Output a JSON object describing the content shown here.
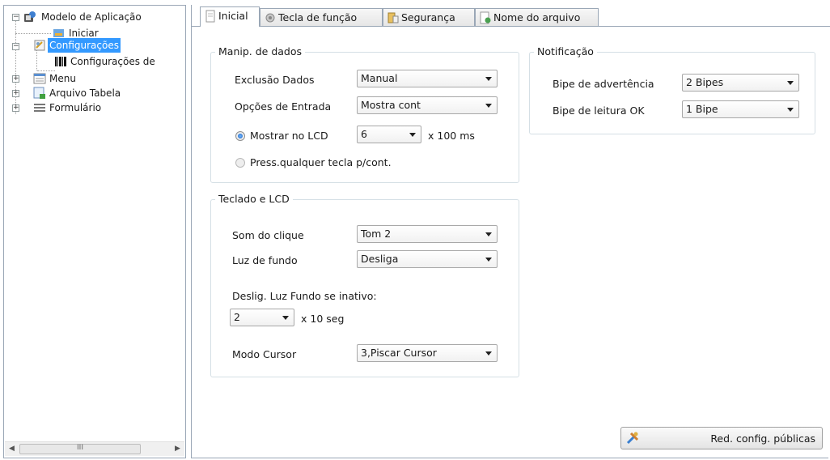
{
  "tree": {
    "root": "Modelo de Aplicação",
    "items": [
      {
        "label": "Iniciar",
        "icon": "start-icon"
      },
      {
        "label": "Configurações",
        "icon": "settings-icon",
        "selected": true
      },
      {
        "label": "Configurações de",
        "icon": "barcode-icon"
      },
      {
        "label": "Menu",
        "icon": "menu-icon"
      },
      {
        "label": "Arquivo Tabela",
        "icon": "table-file-icon"
      },
      {
        "label": "Formulário",
        "icon": "form-icon"
      }
    ],
    "scroll_glyph": "III"
  },
  "tabs": [
    {
      "label": "Inicial",
      "icon": "document-icon",
      "active": true
    },
    {
      "label": "Tecla de função",
      "icon": "function-key-icon"
    },
    {
      "label": "Segurança",
      "icon": "security-icon"
    },
    {
      "label": "Nome do arquivo",
      "icon": "file-name-icon"
    }
  ],
  "data_handling": {
    "title": "Manip. de dados",
    "delete_label": "Exclusão Dados",
    "delete_value": "Manual",
    "input_label": "Opções de Entrada",
    "input_value": "Mostra cont",
    "show_lcd_label": "Mostrar no LCD",
    "show_lcd_value": "6",
    "show_lcd_unit": "x 100 ms",
    "press_key_label": "Press.qualquer tecla p/cont."
  },
  "keypad": {
    "title": "Teclado e LCD",
    "click_label": "Som do clique",
    "click_value": "Tom 2",
    "backlight_label": "Luz de fundo",
    "backlight_value": "Desliga",
    "idle_label": "Deslig. Luz Fundo se inativo:",
    "idle_value": "2",
    "idle_unit": "x 10 seg",
    "cursor_label": "Modo Cursor",
    "cursor_value": "3,Piscar Cursor"
  },
  "notification": {
    "title": "Notificação",
    "warn_label": "Bipe de advertência",
    "warn_value": "2 Bipes",
    "ok_label": "Bipe de leitura OK",
    "ok_value": "1 Bipe"
  },
  "footer": {
    "reduce_label": "Red. config. públicas"
  },
  "colors": {
    "selection": "#3399ff",
    "border": "#9aa7b6"
  }
}
